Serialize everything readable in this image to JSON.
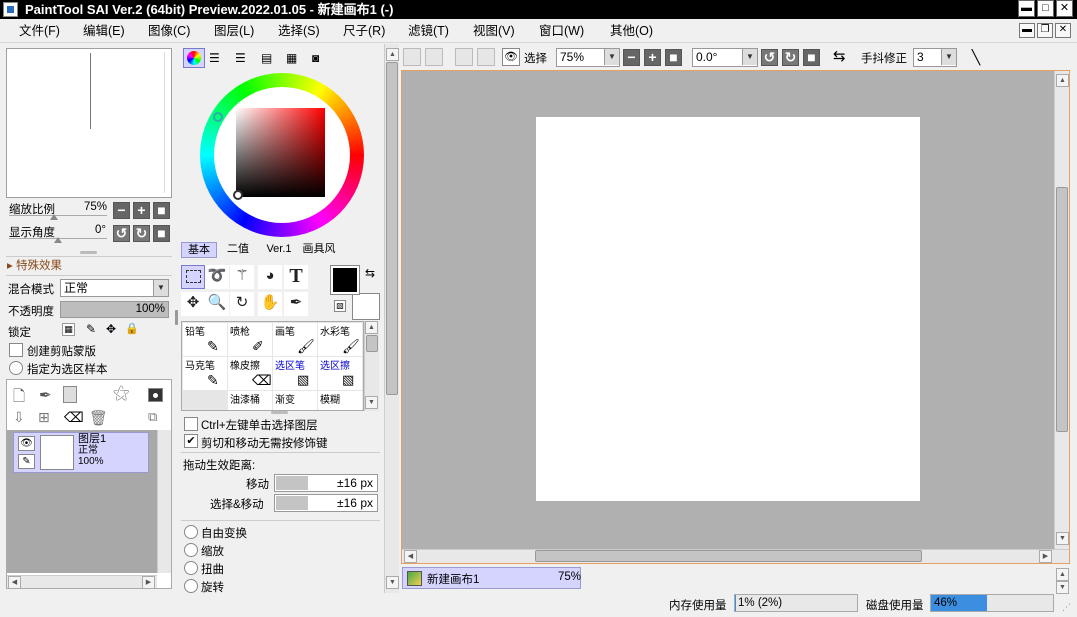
{
  "window": {
    "title": "PaintTool SAI Ver.2 (64bit) Preview.2022.01.05 - 新建画布1 (-)"
  },
  "menu": [
    "文件(F)",
    "编辑(E)",
    "图像(C)",
    "图层(L)",
    "选择(S)",
    "尺子(R)",
    "滤镜(T)",
    "视图(V)",
    "窗口(W)",
    "其他(O)"
  ],
  "navigator": {
    "zoom_label": "缩放比例",
    "zoom_value": "75%",
    "angle_label": "显示角度",
    "angle_value": "0°"
  },
  "special_effects": {
    "label": "特殊效果"
  },
  "layer_props": {
    "blend_label": "混合模式",
    "blend_value": "正常",
    "opacity_label": "不透明度",
    "opacity_value": "100%",
    "opacity_level": 1.0,
    "lock_label": "锁定",
    "clipping_label": "创建剪贴蒙版",
    "selection_source_label": "指定为选区样本"
  },
  "layers": [
    {
      "name": "图层1",
      "mode": "正常",
      "opacity": "100%"
    }
  ],
  "color_tabs": [
    "基本",
    "二值",
    "Ver.1",
    "画具风"
  ],
  "tools": [
    "selection-rect-icon",
    "lasso-icon",
    "magic-wand-icon",
    "shape-fill-icon",
    "text-icon",
    "move-icon",
    "zoom-icon",
    "rotate-icon",
    "hand-icon",
    "eyedropper-icon"
  ],
  "brushes": [
    {
      "label": "铅笔",
      "color": "#000000"
    },
    {
      "label": "喷枪",
      "color": "#000000"
    },
    {
      "label": "画笔",
      "color": "#000000"
    },
    {
      "label": "水彩笔",
      "color": "#000000"
    },
    {
      "label": "马克笔",
      "color": "#000000"
    },
    {
      "label": "橡皮擦",
      "color": "#000000"
    },
    {
      "label": "选区笔",
      "color": "#0000cc"
    },
    {
      "label": "选区擦",
      "color": "#0000cc"
    },
    {
      "label": "",
      "color": "#000000"
    },
    {
      "label": "油漆桶",
      "color": "#000000"
    },
    {
      "label": "渐变",
      "color": "#000000"
    },
    {
      "label": "模糊",
      "color": "#000000"
    }
  ],
  "tool_options": {
    "ctrl_click_label": "Ctrl+左键单击选择图层",
    "cut_move_label": "剪切和移动无需按修饰键",
    "drag_distance_label": "拖动生效距离:",
    "move_label": "移动",
    "move_value": "±16 px",
    "select_move_label": "选择&移动",
    "select_move_value": "±16 px",
    "transforms": [
      "自由变换",
      "缩放",
      "扭曲",
      "旋转"
    ]
  },
  "view_toolbar": {
    "view_label": "选择",
    "zoom_value": "75%",
    "angle_value": "0.0°",
    "stabilizer_label": "手抖修正",
    "stabilizer_value": "3"
  },
  "canvas_tab": {
    "name": "新建画布1",
    "zoom": "75%"
  },
  "status": {
    "memory_label": "内存使用量",
    "memory_value": "1% (2%)",
    "memory_level": 0.01,
    "disk_label": "磁盘使用量",
    "disk_value": "46%",
    "disk_level": 0.46
  },
  "colors": {
    "accent": "#3c8fe0",
    "selection_bg": "#d4d4ff",
    "canvas_bg": "#b0b0b0",
    "title_bar": "#000000"
  }
}
